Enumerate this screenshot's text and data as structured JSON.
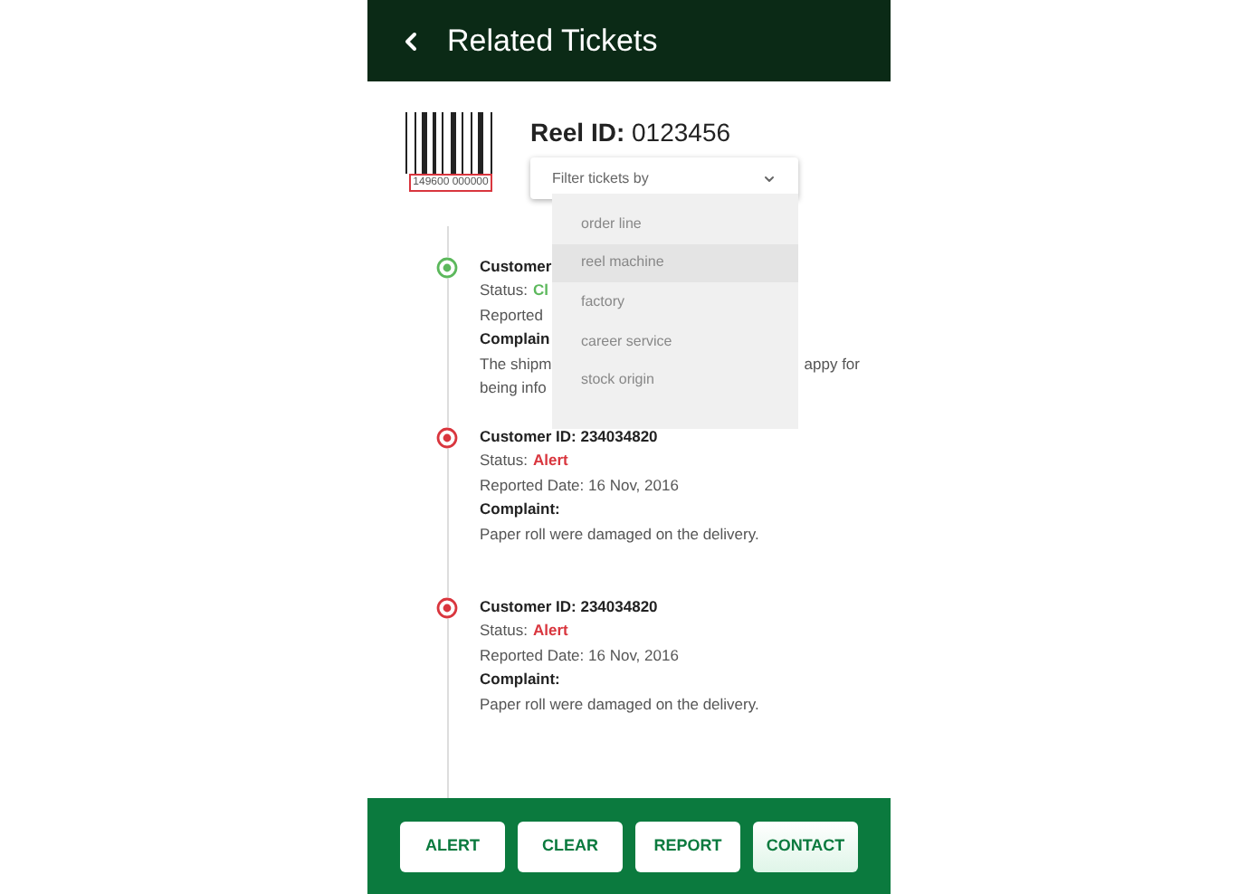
{
  "header": {
    "title": "Related Tickets"
  },
  "reel": {
    "barcode_number": "149600 000000",
    "label": "Reel ID:",
    "value": "0123456"
  },
  "filter": {
    "placeholder": "Filter tickets by",
    "expanded": true,
    "options": [
      {
        "label": "order line",
        "selected": false
      },
      {
        "label": "reel machine",
        "selected": true
      },
      {
        "label": "factory",
        "selected": false
      },
      {
        "label": "career service",
        "selected": false
      },
      {
        "label": "stock origin",
        "selected": false
      }
    ]
  },
  "tickets": [
    {
      "kind": "clear",
      "customer": "Customer",
      "status_label": "Status:",
      "status": "Cl",
      "date": "Reported",
      "complaint_label": "Complain",
      "complaint": [
        [
          "The shipm",
          "appy for"
        ],
        [
          "being info"
        ]
      ]
    },
    {
      "kind": "alert",
      "customer": "Customer ID: 234034820",
      "status_label": "Status:",
      "status": "Alert",
      "date": "Reported Date: 16 Nov, 2016",
      "complaint_label": "Complaint:",
      "complaint": [
        [
          "Paper roll were damaged on the delivery."
        ]
      ]
    },
    {
      "kind": "alert",
      "customer": "Customer ID: 234034820",
      "status_label": "Status:",
      "status": "Alert",
      "date": "Reported Date: 16 Nov, 2016",
      "complaint_label": "Complaint:",
      "complaint": [
        [
          "Paper roll were damaged on the delivery."
        ]
      ]
    }
  ],
  "buttons": [
    {
      "label": "ALERT",
      "selected": false
    },
    {
      "label": "CLEAR",
      "selected": false
    },
    {
      "label": "REPORT",
      "selected": false
    },
    {
      "label": "CONTACT",
      "selected": true
    }
  ]
}
